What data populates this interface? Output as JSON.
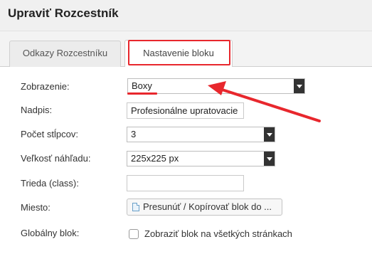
{
  "header": {
    "title": "Upraviť Rozcestník"
  },
  "tabs": [
    {
      "label": "Odkazy Rozcestníku"
    },
    {
      "label": "Nastavenie bloku"
    }
  ],
  "form": {
    "zobrazenie": {
      "label": "Zobrazenie:",
      "value": "Boxy"
    },
    "nadpis": {
      "label": "Nadpis:",
      "value": "Profesionálne upratovacie"
    },
    "pocet_stlpcov": {
      "label": "Počet stĺpcov:",
      "value": "3"
    },
    "velkost_nahladu": {
      "label": "Veľkosť náhľadu:",
      "value": "225x225 px"
    },
    "trieda": {
      "label": "Trieda (class):",
      "value": ""
    },
    "miesto": {
      "label": "Miesto:",
      "button_label": "Presunúť / Kopírovať blok do ..."
    },
    "globalny_blok": {
      "label": "Globálny blok:",
      "checkbox_label": "Zobraziť blok na všetkých stránkach",
      "checked": false
    }
  },
  "annotation": {
    "color": "#e8272d"
  },
  "icons": {
    "select_arrow": "chevron-down-icon",
    "document": "document-icon"
  }
}
